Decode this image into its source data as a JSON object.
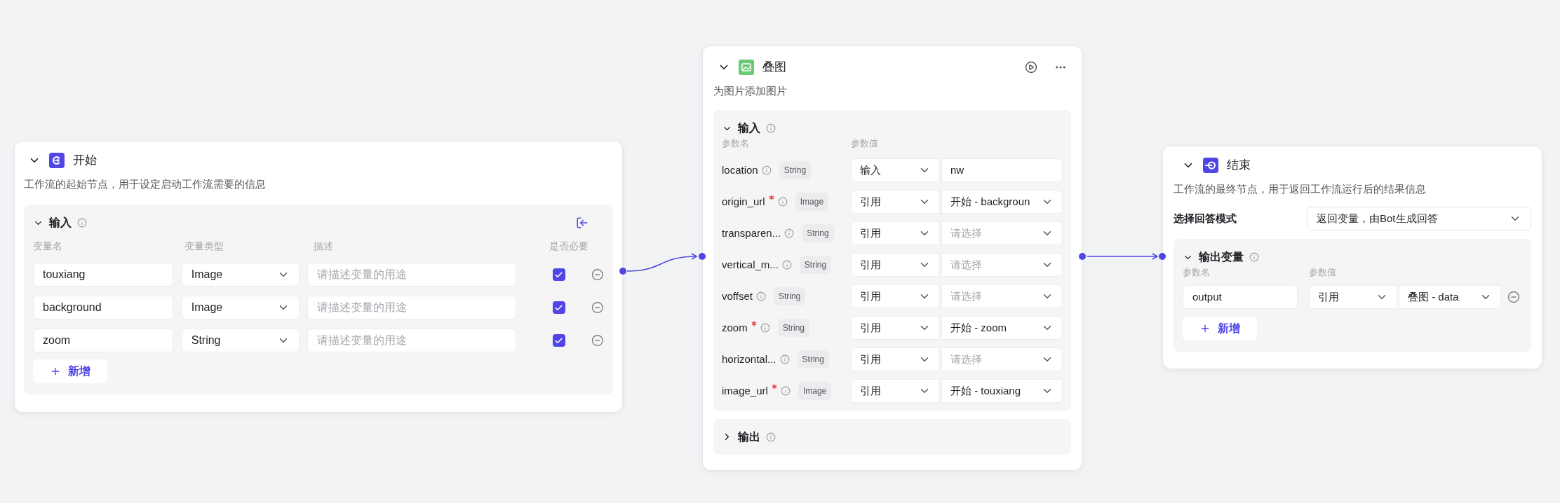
{
  "start_node": {
    "title": "开始",
    "description": "工作流的起始节点，用于设定启动工作流需要的信息",
    "expanded": true,
    "inputs": {
      "title": "输入",
      "expanded": true,
      "columns": [
        "变量名",
        "变量类型",
        "描述",
        "是否必要"
      ],
      "rows": [
        {
          "name": "touxiang",
          "type": "Image",
          "description_placeholder": "请描述变量的用途",
          "required": true
        },
        {
          "name": "background",
          "type": "Image",
          "description_placeholder": "请描述变量的用途",
          "required": true
        },
        {
          "name": "zoom",
          "type": "String",
          "description_placeholder": "请描述变量的用途",
          "required": true
        }
      ],
      "add_button": "新增"
    }
  },
  "overlay_node": {
    "title": "叠图",
    "description": "为图片添加图片",
    "expanded": true,
    "inputs": {
      "title": "输入",
      "expanded": true,
      "columns": [
        "参数名",
        "参数值"
      ],
      "rows": [
        {
          "name": "location",
          "required": false,
          "type": "String",
          "source": "输入",
          "kind": "literal",
          "value": "nw"
        },
        {
          "name": "origin_url",
          "required": true,
          "type": "Image",
          "source": "引用",
          "kind": "reference",
          "value": "开始 - backgroun"
        },
        {
          "name": "transparen...",
          "required": false,
          "type": "String",
          "source": "引用",
          "kind": "reference",
          "placeholder": "请选择"
        },
        {
          "name": "vertical_m...",
          "required": false,
          "type": "String",
          "source": "引用",
          "kind": "reference",
          "placeholder": "请选择"
        },
        {
          "name": "voffset",
          "required": false,
          "type": "String",
          "source": "引用",
          "kind": "reference",
          "placeholder": "请选择"
        },
        {
          "name": "zoom",
          "required": true,
          "type": "String",
          "source": "引用",
          "kind": "reference",
          "value": "开始 - zoom"
        },
        {
          "name": "horizontal...",
          "required": false,
          "type": "String",
          "source": "引用",
          "kind": "reference",
          "placeholder": "请选择"
        },
        {
          "name": "image_url",
          "required": true,
          "type": "Image",
          "source": "引用",
          "kind": "reference",
          "value": "开始 - touxiang"
        }
      ]
    },
    "outputs": {
      "title": "输出",
      "expanded": false
    }
  },
  "end_node": {
    "title": "结束",
    "description": "工作流的最终节点，用于返回工作流运行后的结果信息",
    "expanded": true,
    "mode_label": "选择回答模式",
    "mode_value": "返回变量，由Bot生成回答",
    "outputs": {
      "title": "输出变量",
      "expanded": true,
      "columns": [
        "参数名",
        "参数值"
      ],
      "rows": [
        {
          "name": "output",
          "source": "引用",
          "value": "叠图 - data"
        }
      ],
      "add_button": "新增"
    }
  }
}
